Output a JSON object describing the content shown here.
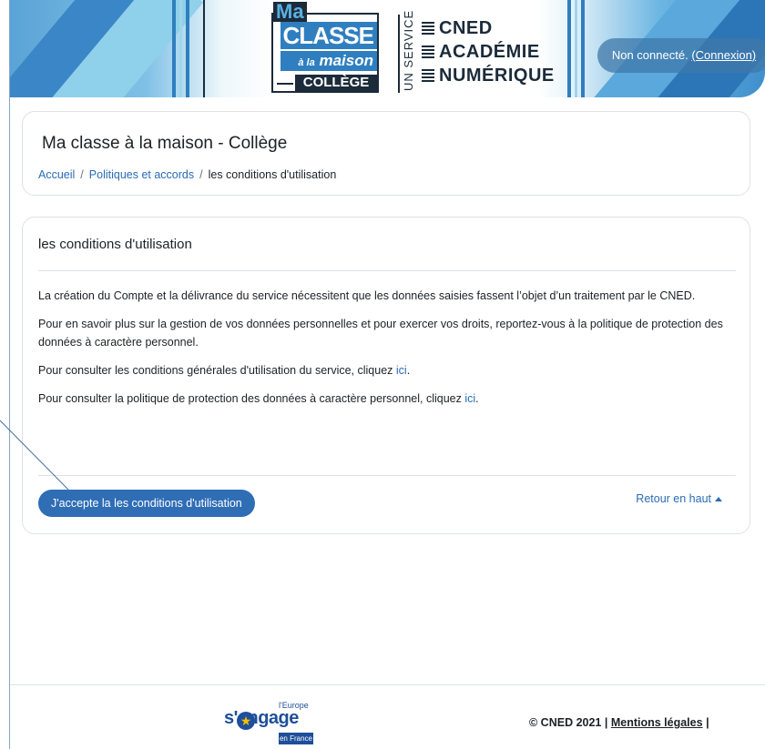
{
  "header": {
    "logo": {
      "ma": "Ma",
      "classe": "CLASSE",
      "a_la": "à la",
      "maison": "maison",
      "college": "COLLÈGE"
    },
    "un_service": "UN SERVICE",
    "cned_lines": [
      "CNED",
      "ACADÉMIE",
      "NUMÉRIQUE"
    ],
    "login_status": "Non connecté.",
    "login_link": "(Connexion)"
  },
  "page_header": {
    "title": "Ma classe à la maison - Collège",
    "breadcrumb": {
      "home": "Accueil",
      "separator": "/",
      "policies": "Politiques et accords",
      "current": "les conditions d'utilisation"
    }
  },
  "main": {
    "title": "les conditions d'utilisation",
    "paragraphs": {
      "p1": "La création du Compte et la délivrance du service nécessitent que les données saisies fassent l’objet d’un traitement par le CNED.",
      "p2": "Pour en savoir plus sur la gestion de vos données personnelles et pour exercer vos droits, reportez-vous à la politique de protection des données à caractère personnel.",
      "p3_text": "Pour consulter les conditions générales d'utilisation du service, cliquez",
      "p3_link": "ici",
      "p3_end": ".",
      "p4_text": "Pour consulter la politique de protection des données à caractère personnel, cliquez",
      "p4_link": "ici",
      "p4_end": "."
    },
    "accept_button": "J'accepte la les conditions d'utilisation",
    "back_to_top": "Retour en haut"
  },
  "footer": {
    "eu_logo": {
      "small": "l'Europe",
      "word": "s'engage",
      "france": "en France"
    },
    "copyright": "© CNED 2021 |",
    "legal_link": "Mentions légales",
    "trailing_sep": "|"
  },
  "colors": {
    "accent": "#2f6db5",
    "link": "#2a6bb5",
    "login_pill": "#3f78aa"
  }
}
